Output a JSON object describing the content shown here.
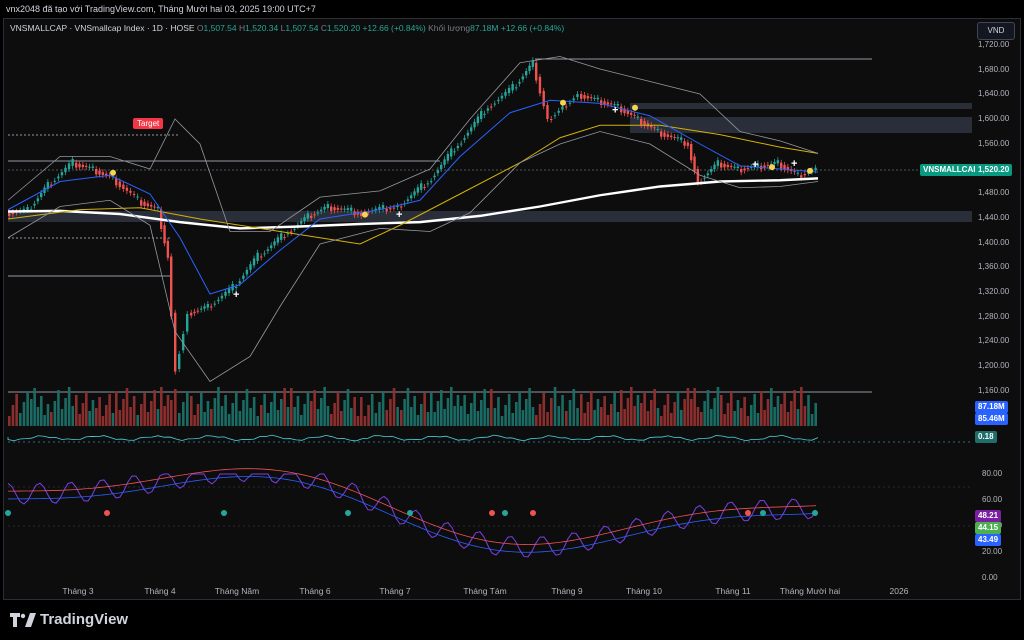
{
  "header": {
    "author_line": "vnx2048 đã tạo với TradingView.com, Tháng Mười hai 03, 2025 19:00 UTC+7"
  },
  "legend": {
    "symbol": "VNSMALLCAP · VNSmallcap Index · 1D · HOSE",
    "o_label": "O",
    "o": "1,507.54",
    "h_label": "H",
    "h": "1,520.34",
    "l_label": "L",
    "l": "1,507.54",
    "c_label": "C",
    "c": "1,520.20",
    "change": "+12.66 (+0.84%)",
    "vol_label": "Khối lượng",
    "vol": "87.18M",
    "vol_change": "+12.66 (+0.84%)"
  },
  "currency_button": "VND",
  "price_axis": {
    "ticks": [
      "1,720.00",
      "1,680.00",
      "1,640.00",
      "1,600.00",
      "1,560.00",
      "1,520.00",
      "1,480.00",
      "1,440.00",
      "1,400.00",
      "1,360.00",
      "1,320.00",
      "1,280.00",
      "1,240.00",
      "1,200.00",
      "1,160.00"
    ],
    "symbol_tag": "VNSMALLCAP",
    "last_price": "1,520.20",
    "volume_tag_1": "87.18M",
    "volume_tag_2": "85.46M",
    "ratio_tag": "0.18"
  },
  "oscillator_axis": {
    "ticks": [
      "80.00",
      "60.00",
      "40.00",
      "20.00",
      "0.00"
    ],
    "tag_1": "48.21",
    "tag_2": "44.15",
    "tag_3": "43.49"
  },
  "annotations": {
    "target_label": "Target"
  },
  "time_axis": [
    "Tháng 3",
    "Tháng 4",
    "Tháng Năm",
    "Tháng 6",
    "Tháng 7",
    "Tháng Tám",
    "Tháng 9",
    "Tháng 10",
    "Tháng 11",
    "Tháng Mười hai",
    "2026"
  ],
  "footer": {
    "brand": "TradingView"
  },
  "colors": {
    "up": "#26a69a",
    "down": "#ef5350",
    "ma_white": "#ffffff",
    "ma_blue": "#2962ff",
    "ma_yellow": "#d4b106",
    "bollinger": "#9598a1",
    "symbol_tag_bg": "#089981",
    "vol_tag_1": "#2962ff",
    "vol_tag_2": "#2962ff",
    "osc_tag_1": "#7b1fa2",
    "osc_tag_2": "#4caf50",
    "osc_tag_3": "#2962ff"
  }
}
